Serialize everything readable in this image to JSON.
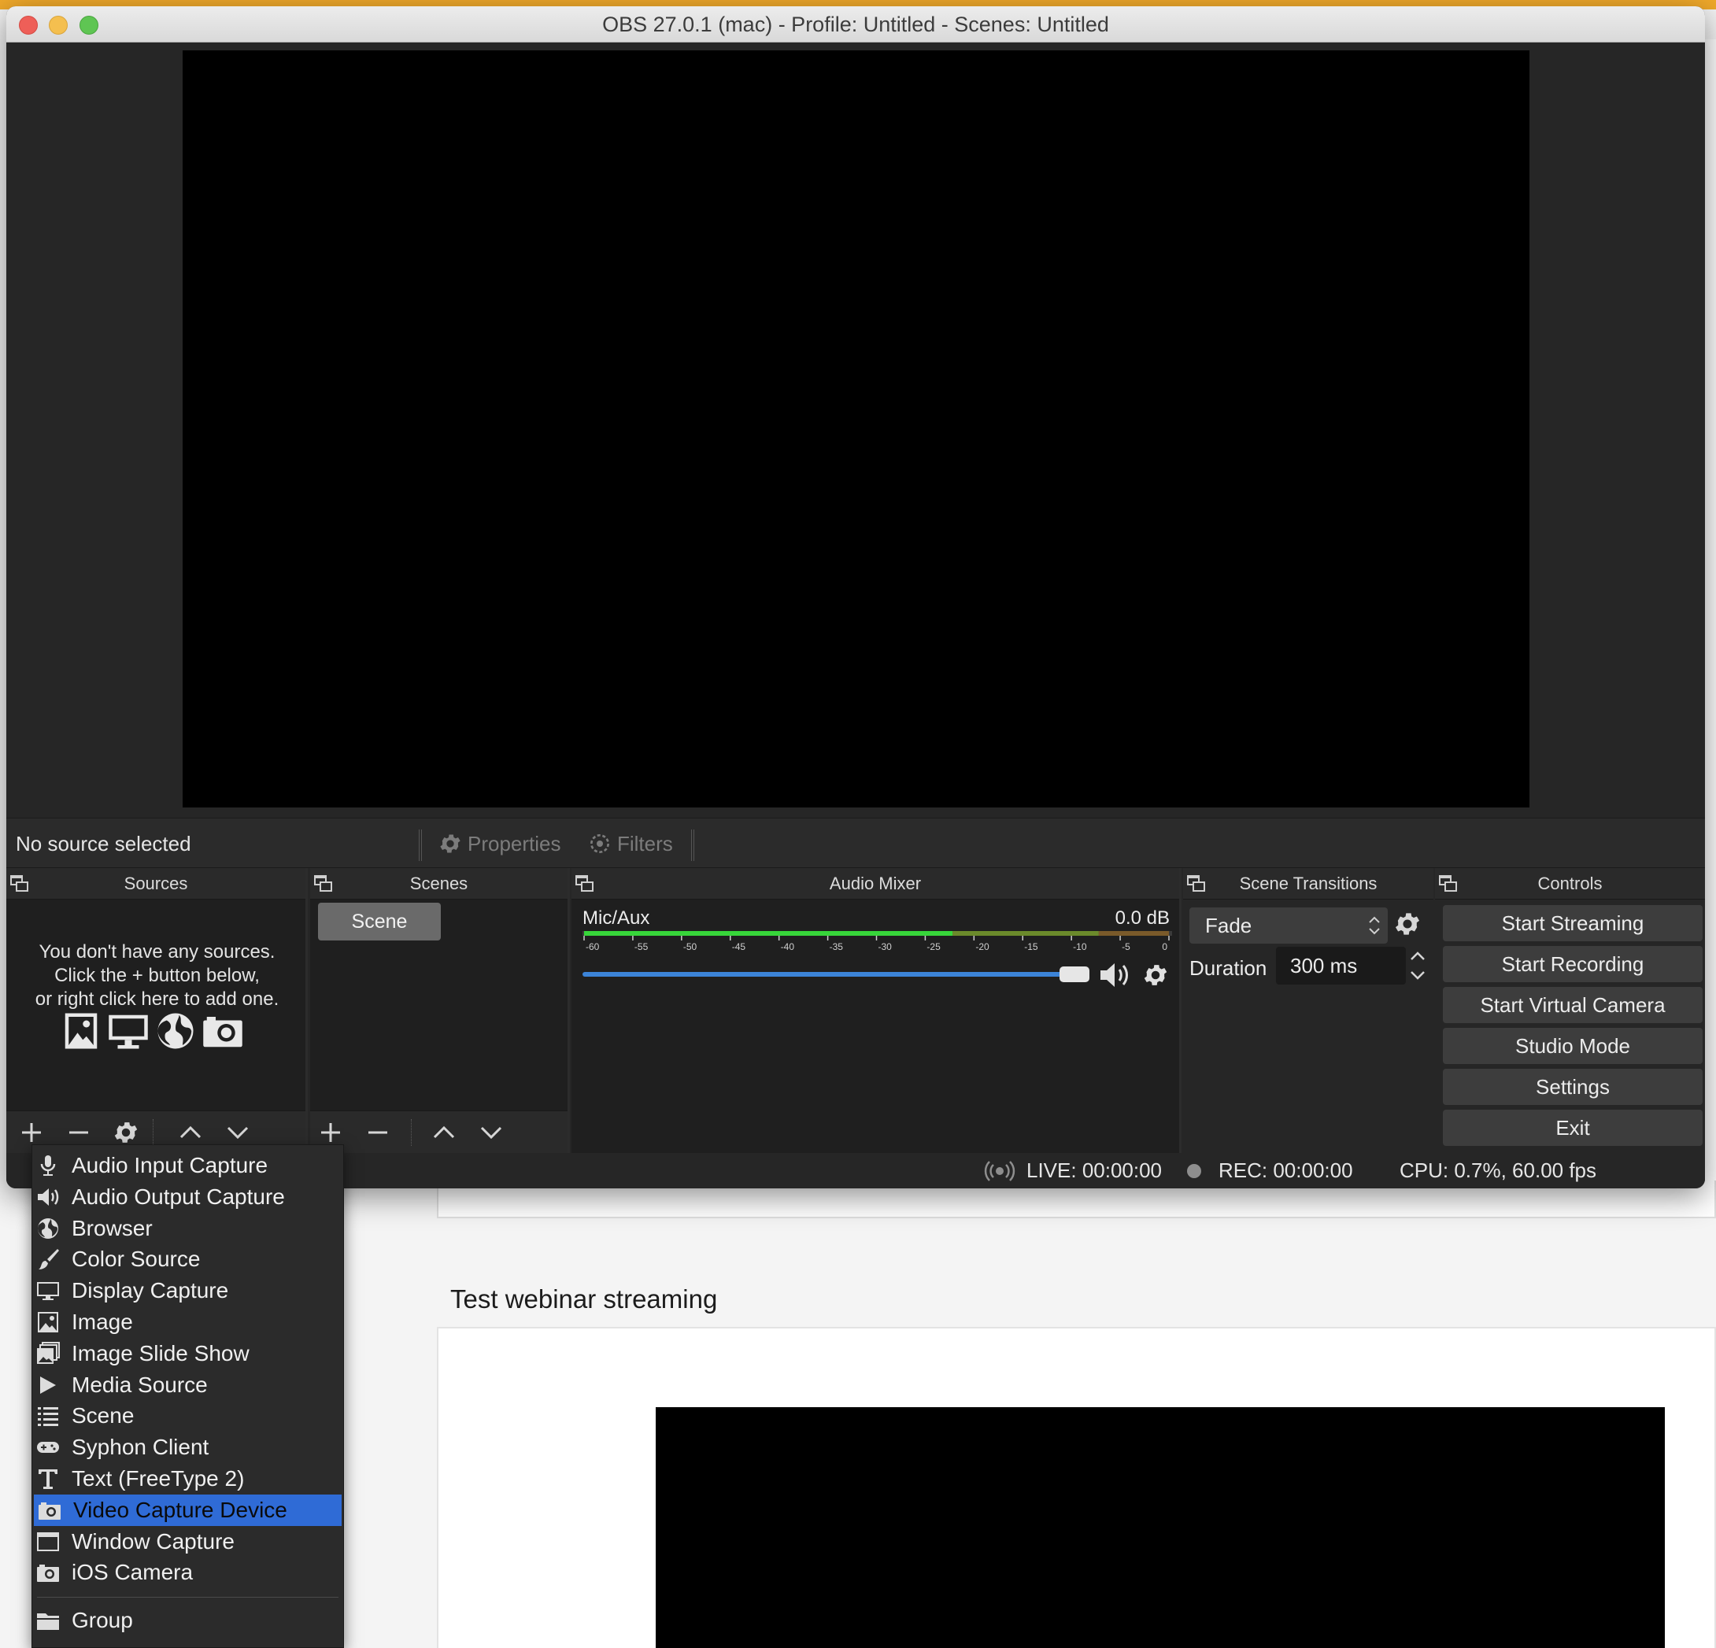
{
  "window": {
    "title": "OBS 27.0.1 (mac) - Profile: Untitled - Scenes: Untitled"
  },
  "source_toolbar": {
    "no_source": "No source selected",
    "properties": "Properties",
    "filters": "Filters"
  },
  "docks": {
    "sources": {
      "title": "Sources",
      "empty_line1": "You don't have any sources.",
      "empty_line2": "Click the + button below,",
      "empty_line3": "or right click here to add one."
    },
    "scenes": {
      "title": "Scenes",
      "items": [
        "Scene"
      ]
    },
    "mixer": {
      "title": "Audio Mixer",
      "channel": "Mic/Aux",
      "level": "0.0 dB",
      "meter_ticks": [
        "-60",
        "-55",
        "-50",
        "-45",
        "-40",
        "-35",
        "-30",
        "-25",
        "-20",
        "-15",
        "-10",
        "-5",
        "0"
      ],
      "volume_fraction": 1.0
    },
    "transitions": {
      "title": "Scene Transitions",
      "selected": "Fade",
      "duration_label": "Duration",
      "duration_value": "300 ms"
    },
    "controls": {
      "title": "Controls",
      "buttons": [
        "Start Streaming",
        "Start Recording",
        "Start Virtual Camera",
        "Studio Mode",
        "Settings",
        "Exit"
      ]
    }
  },
  "status": {
    "live": "LIVE: 00:00:00",
    "rec": "REC: 00:00:00",
    "cpu": "CPU: 0.7%, 60.00 fps"
  },
  "context_menu": {
    "items": [
      {
        "label": "Audio Input Capture",
        "icon": "microphone-icon"
      },
      {
        "label": "Audio Output Capture",
        "icon": "speaker-icon"
      },
      {
        "label": "Browser",
        "icon": "globe-icon"
      },
      {
        "label": "Color Source",
        "icon": "paint-brush-icon"
      },
      {
        "label": "Display Capture",
        "icon": "monitor-icon"
      },
      {
        "label": "Image",
        "icon": "image-icon"
      },
      {
        "label": "Image Slide Show",
        "icon": "slideshow-icon"
      },
      {
        "label": "Media Source",
        "icon": "play-icon"
      },
      {
        "label": "Scene",
        "icon": "list-icon"
      },
      {
        "label": "Syphon Client",
        "icon": "gamepad-icon"
      },
      {
        "label": "Text (FreeType 2)",
        "icon": "text-icon"
      },
      {
        "label": "Video Capture Device",
        "icon": "camera-icon",
        "selected": true
      },
      {
        "label": "Window Capture",
        "icon": "window-icon"
      },
      {
        "label": "iOS Camera",
        "icon": "camera-icon"
      }
    ],
    "group": {
      "label": "Group",
      "icon": "folder-icon"
    }
  },
  "background_page": {
    "heading": "Test webinar streaming"
  },
  "colors": {
    "accent": "#2f6bd6",
    "slider": "#3c84d8",
    "meter_green": "#37d63a",
    "window_bg": "#262626"
  }
}
